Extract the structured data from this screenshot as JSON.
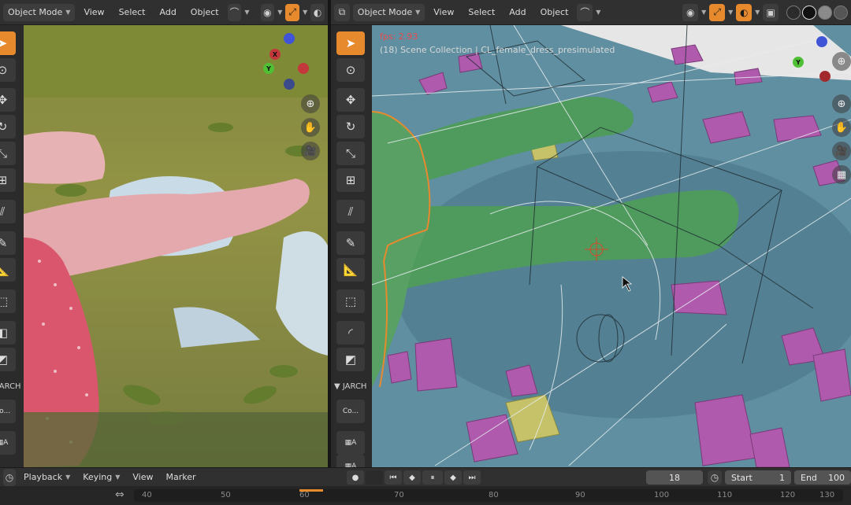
{
  "left_header": {
    "mode_label": "Object Mode",
    "menu_view": "View",
    "menu_select": "Select",
    "menu_add": "Add",
    "menu_object": "Object"
  },
  "right_header": {
    "mode_label": "Object Mode",
    "menu_view": "View",
    "menu_select": "Select",
    "menu_add": "Add",
    "menu_object": "Object"
  },
  "viewport_overlay": {
    "fps": "fps: 2.93",
    "collection": "(18) Scene Collection | CL_female_dress_presimulated"
  },
  "toolbar": {
    "section_label": "JARCH",
    "left_section_label": "JARCH",
    "co_label": "Co...",
    "a_label": "A"
  },
  "timeline": {
    "playback": "Playback",
    "keying": "Keying",
    "view": "View",
    "marker": "Marker",
    "current_frame": "18",
    "start_label": "Start",
    "start_value": "1",
    "end_label": "End",
    "end_value": "100",
    "ruler_numbers": [
      "40",
      "50",
      "60",
      "70",
      "80",
      "90",
      "100",
      "110",
      "120",
      "130"
    ]
  },
  "axes": {
    "x": "X",
    "y": "Y",
    "z": "Z"
  },
  "colors": {
    "accent": "#e78a2e",
    "fps_red": "#e84b4b",
    "body_green": "#4f9a5d",
    "floor_blue": "#5f8fa0",
    "shard_magenta": "#b05aae",
    "dress_pink": "#d9566c"
  },
  "icons": {
    "cursor": "cursor-icon",
    "move": "move-icon",
    "rotate": "rotate-icon",
    "scale": "scale-icon",
    "transform": "transform-icon",
    "annotate": "annotate-icon",
    "measure": "measure-icon",
    "add_cube": "add-cube-icon",
    "knife": "knife-icon"
  }
}
